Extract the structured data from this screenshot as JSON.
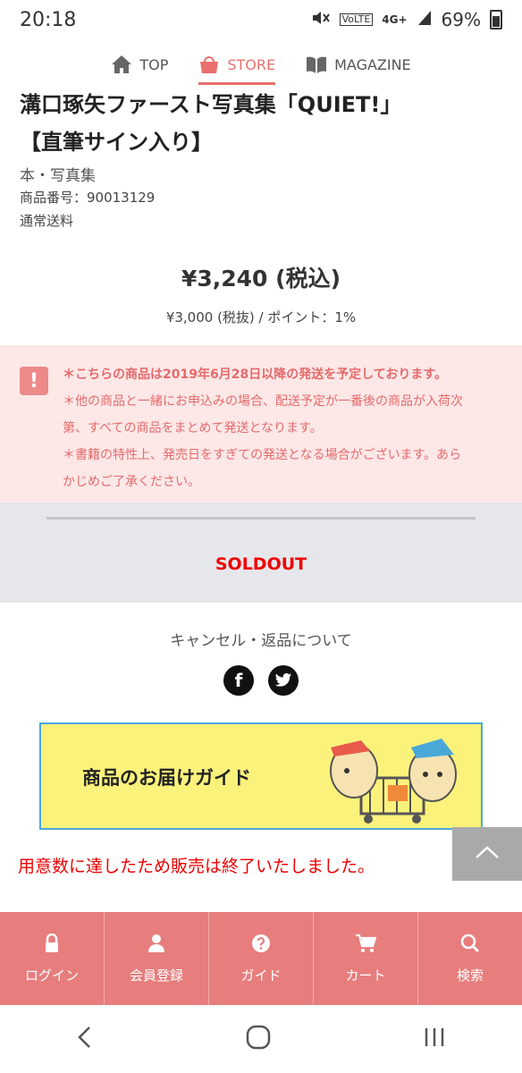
{
  "status_bar": {
    "time": "20:18",
    "network": "4G+",
    "volte": "VoLTE",
    "battery": "69%"
  },
  "top_nav": {
    "items": [
      {
        "label": "TOP",
        "icon": "home-icon"
      },
      {
        "label": "STORE",
        "icon": "basket-icon",
        "active": true
      },
      {
        "label": "MAGAZINE",
        "icon": "book-icon"
      }
    ]
  },
  "product": {
    "title_line1": "溝口琢矢ファースト写真集「QUIET!」",
    "title_line2": "【直筆サイン入り】",
    "category": "本・写真集",
    "product_number": "商品番号：90013129",
    "shipping": "通常送料",
    "price_main": "¥3,240 (税込)",
    "price_sub": "¥3,000 (税抜) / ポイント：1%"
  },
  "notice": {
    "icon": "!",
    "lines": [
      "＊こちらの商品は2019年6月28日以降の発送を予定しております。",
      "＊他の商品と一緒にお申込みの場合、配送予定が一番後の商品が入荷次",
      "第、すべての商品をまとめて発送となります。",
      "＊書籍の特性上、発売日をすぎての発送となる場合がございます。あら",
      "かじめご了承ください。"
    ]
  },
  "soldout": {
    "label": "SOLDOUT"
  },
  "links": {
    "cancel_returns": "キャンセル・返品について"
  },
  "social": {
    "facebook": "f",
    "twitter": "t"
  },
  "banner": {
    "text": "商品のお届けガイド"
  },
  "sold_message": "用意数に達したため販売は終了いたしました。",
  "bottom_bar": {
    "items": [
      {
        "label": "ログイン",
        "icon": "lock-icon"
      },
      {
        "label": "会員登録",
        "icon": "user-icon"
      },
      {
        "label": "ガイド",
        "icon": "question-icon"
      },
      {
        "label": "カート",
        "icon": "cart-icon"
      },
      {
        "label": "検索",
        "icon": "search-icon"
      }
    ]
  },
  "colors": {
    "accent": "#e77d7d",
    "notice_bg": "#fde7e7",
    "notice_text": "#e46a6a",
    "soldout_red": "#e00000",
    "banner_yellow": "#fbf27b"
  }
}
